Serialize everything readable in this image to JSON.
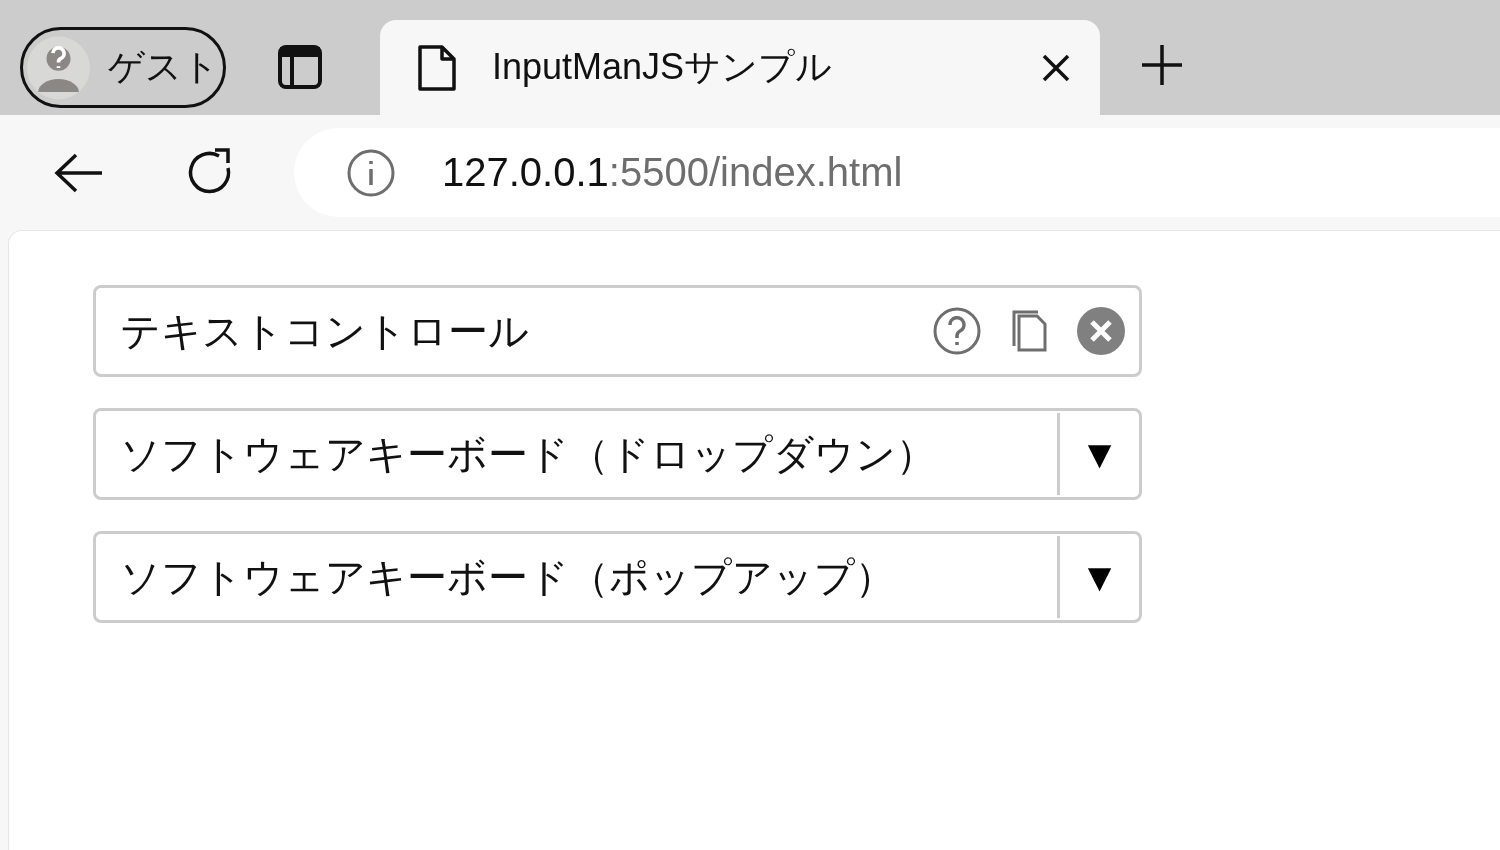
{
  "browser": {
    "profile": {
      "label": "ゲスト"
    },
    "tab": {
      "title": "InputManJSサンプル"
    },
    "address": {
      "host": "127.0.0.1",
      "path": ":5500/index.html"
    }
  },
  "controls": [
    {
      "kind": "text",
      "value": "テキストコントロール"
    },
    {
      "kind": "dropdown",
      "value": "ソフトウェアキーボード（ドロップダウン）",
      "button": "▼"
    },
    {
      "kind": "dropdown",
      "value": "ソフトウェアキーボード（ポップアップ）",
      "button": "▼"
    }
  ]
}
